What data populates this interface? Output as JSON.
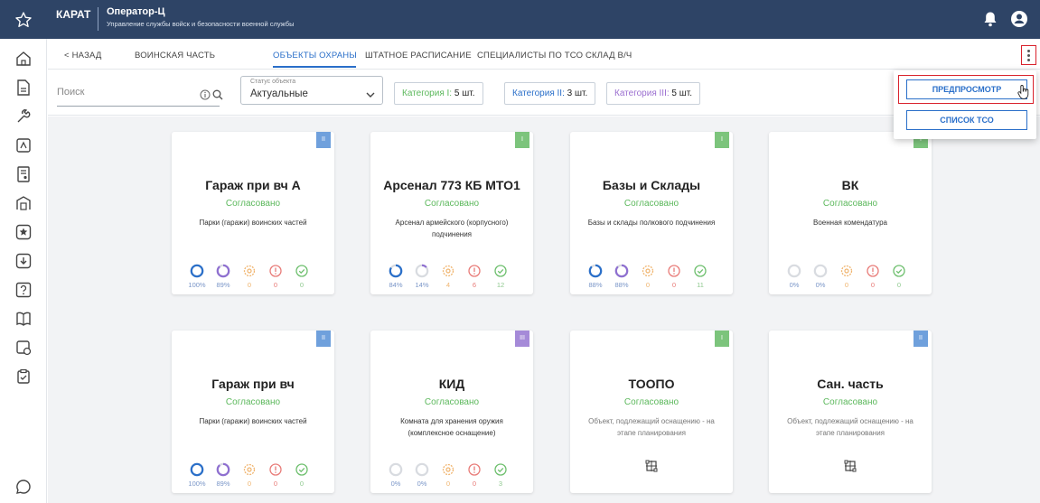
{
  "header": {
    "brand": "КАРАТ",
    "title": "Оператор-Ц",
    "subtitle": "Управление службы войск и безопасности военной службы"
  },
  "nav": {
    "back": "< НАЗАД",
    "tabs": [
      "ВОИНСКАЯ ЧАСТЬ",
      "ОБЪЕКТЫ ОХРАНЫ",
      "ШТАТНОЕ РАСПИСАНИЕ",
      "СПЕЦИАЛИСТЫ ПО ТСО",
      "СКЛАД В/Ч"
    ],
    "active_tab": "ОБЪЕКТЫ ОХРАНЫ"
  },
  "filter": {
    "search_placeholder": "Поиск",
    "status_label": "Статус объекта",
    "status_value": "Актуальные",
    "categories": [
      {
        "label": "Категория I:",
        "count": "5 шт.",
        "color": "#5cb85c"
      },
      {
        "label": "Категория II:",
        "count": "3 шт.",
        "color": "#2a6fc9"
      },
      {
        "label": "Категория III:",
        "count": "5 шт.",
        "color": "#9b6fd0"
      }
    ]
  },
  "menu": {
    "preview": "ПРЕДПРОСМОТР",
    "tso_list": "СПИСОК ТСО"
  },
  "colors": {
    "header_bg": "#2e4466",
    "accent": "#2a6fc9",
    "approved": "#5cb85c",
    "highlight": "#d9232d",
    "cat1": "#5cb85c",
    "cat2": "#6fa0dc",
    "cat3": "#a58ad8"
  },
  "cards": [
    {
      "title": "Гараж при вч А",
      "status": "Согласовано",
      "desc": "Парки (гаражи) воинских частей",
      "badge": "II",
      "badge_color": "#6fa0dc",
      "stats": [
        "100%",
        "89%",
        "0",
        "0",
        "0"
      ],
      "fill": [
        1.0,
        0.89
      ]
    },
    {
      "title": "Арсенал 773 КБ МТО1",
      "status": "Согласовано",
      "desc": "Арсенал армейского (корпусного) подчинения",
      "badge": "I",
      "badge_color": "#7cc47c",
      "stats": [
        "84%",
        "14%",
        "4",
        "6",
        "12"
      ],
      "fill": [
        0.84,
        0.14
      ]
    },
    {
      "title": "Базы и Склады",
      "status": "Согласовано",
      "desc": "Базы и склады полкового подчинения",
      "badge": "I",
      "badge_color": "#7cc47c",
      "stats": [
        "88%",
        "88%",
        "0",
        "0",
        "11"
      ],
      "fill": [
        0.88,
        0.88
      ]
    },
    {
      "title": "ВК",
      "status": "Согласовано",
      "desc": "Военная комендатура",
      "badge": "I",
      "badge_color": "#7cc47c",
      "stats": [
        "0%",
        "0%",
        "0",
        "0",
        "0"
      ],
      "fill": [
        0,
        0
      ]
    },
    {
      "title": "Гараж при вч",
      "status": "Согласовано",
      "desc": "Парки (гаражи) воинских частей",
      "badge": "II",
      "badge_color": "#6fa0dc",
      "stats": [
        "100%",
        "89%",
        "0",
        "0",
        "0"
      ],
      "fill": [
        1.0,
        0.89
      ]
    },
    {
      "title": "КИД",
      "status": "Согласовано",
      "desc": "Комната для хранения оружия (комплексное оснащение)",
      "badge": "III",
      "badge_color": "#a58ad8",
      "stats": [
        "0%",
        "0%",
        "0",
        "0",
        "3"
      ],
      "fill": [
        0,
        0
      ]
    },
    {
      "title": "ТООПО",
      "status": "Согласовано",
      "desc": "Объект, подлежащий оснащению - на этапе планирования",
      "badge": "I",
      "badge_color": "#7cc47c",
      "stats": null,
      "fill": null
    },
    {
      "title": "Сан. часть",
      "status": "Согласовано",
      "desc": "Объект, подлежащий оснащению - на этапе планирования",
      "badge": "II",
      "badge_color": "#6fa0dc",
      "stats": null,
      "fill": null
    }
  ]
}
